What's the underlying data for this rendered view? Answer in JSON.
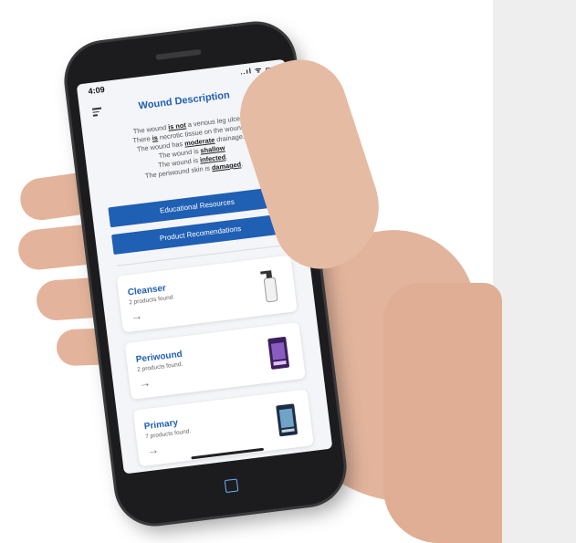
{
  "status": {
    "time": "4:09",
    "icons": "..ıl ᯤ ▭"
  },
  "appbar": {
    "title": "Wound Description"
  },
  "description": [
    {
      "prefix": "The wound ",
      "emph": "is not",
      "suffix": " a venous leg ulcer."
    },
    {
      "prefix": "There ",
      "emph": "is",
      "suffix": " necrotic tissue on the wound."
    },
    {
      "prefix": "The wound has ",
      "emph": "moderate",
      "suffix": " drainage."
    },
    {
      "prefix": "The wound is ",
      "emph": "shallow",
      "suffix": ""
    },
    {
      "prefix": "The wound is ",
      "emph": "infected",
      "suffix": "."
    },
    {
      "prefix": "The periwound skin is ",
      "emph": "damaged",
      "suffix": "."
    }
  ],
  "buttons": {
    "educational": "Educational Resources",
    "products": "Product Recomendations"
  },
  "cards": [
    {
      "name": "Cleanser",
      "count": "2 products found.",
      "arrow": "→"
    },
    {
      "name": "Periwound",
      "count": "2 products found.",
      "arrow": "→"
    },
    {
      "name": "Primary",
      "count": "7 products found.",
      "arrow": "→"
    }
  ],
  "colors": {
    "accent": "#1f5fb4",
    "side_panel": "#eeeeee",
    "skin": "#e2b49c"
  }
}
